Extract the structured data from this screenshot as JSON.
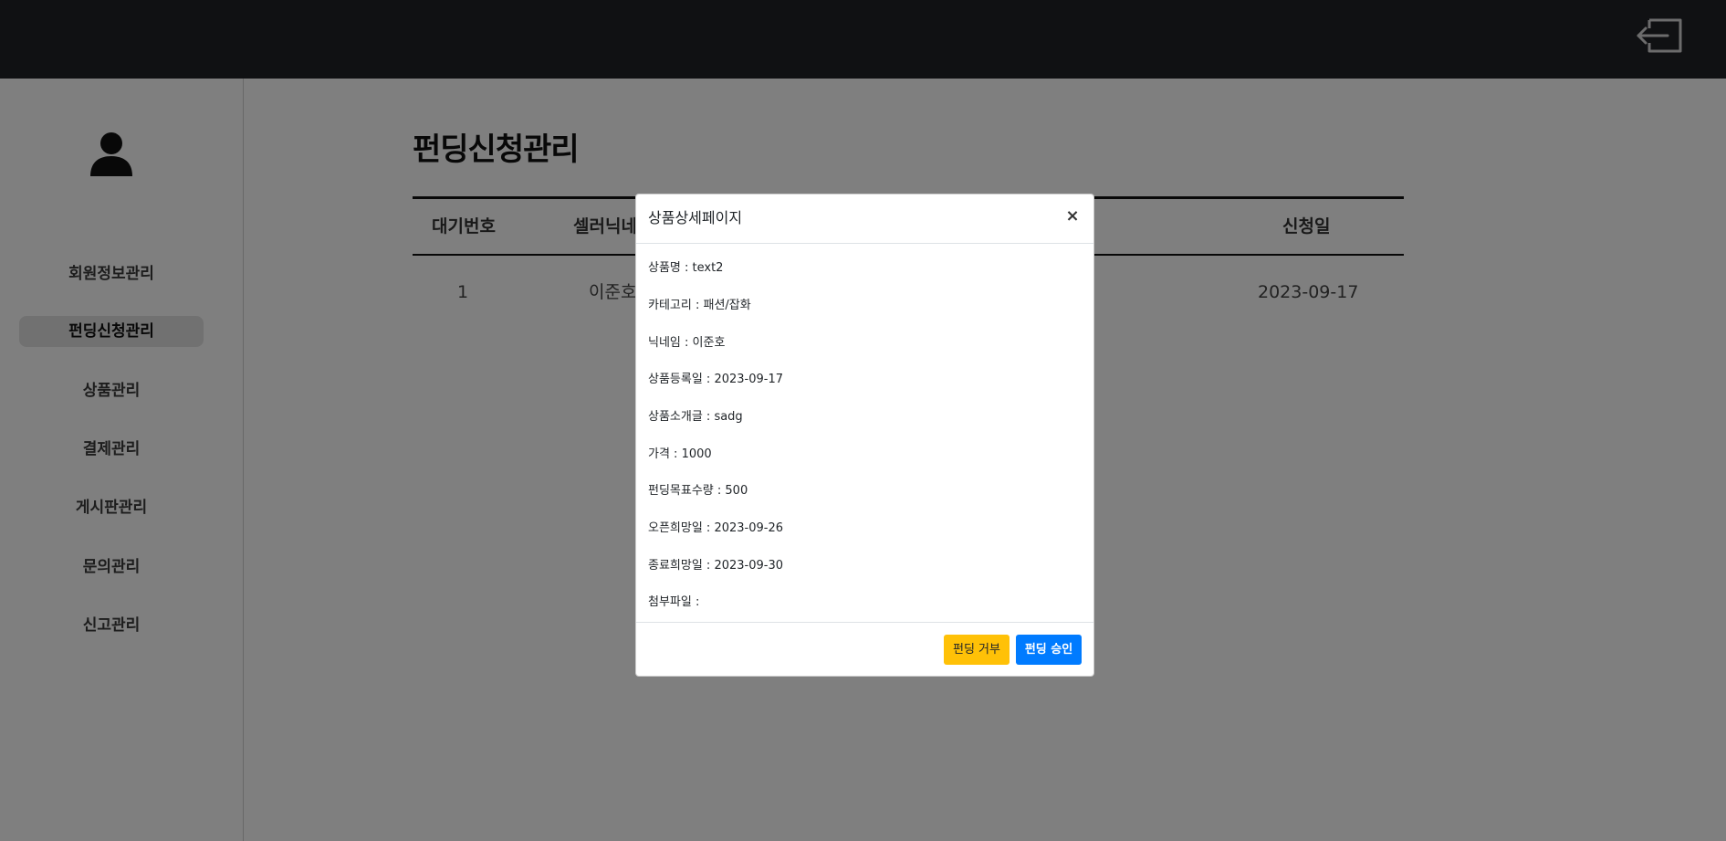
{
  "sidebar": {
    "items": [
      {
        "label": "회원정보관리"
      },
      {
        "label": "펀딩신청관리",
        "active": true
      },
      {
        "label": "상품관리"
      },
      {
        "label": "결제관리"
      },
      {
        "label": "게시판관리"
      },
      {
        "label": "문의관리"
      },
      {
        "label": "신고관리"
      }
    ]
  },
  "main": {
    "title": "펀딩신청관리",
    "table": {
      "headers": [
        "대기번호",
        "셀러닉네",
        "신청일"
      ],
      "rows": [
        [
          "1",
          "이준호",
          "2023-09-17"
        ]
      ]
    }
  },
  "modal": {
    "title": "상품상세페이지",
    "close_glyph": "×",
    "details": [
      "상품명 : text2",
      "카테고리 : 패션/잡화",
      "닉네임 : 이준호",
      "상품등록일 : 2023-09-17",
      "상품소개글 : sadg",
      "가격 : 1000",
      "펀딩목표수량 : 500",
      "오픈희망일 : 2023-09-26",
      "종료희망일 : 2023-09-30",
      "첨부파일 :"
    ],
    "reject_label": "펀딩 거부",
    "approve_label": "펀딩 승인"
  },
  "colors": {
    "topbar": "#212327",
    "reject": "#ffc107",
    "approve": "#007bff"
  },
  "icons": {
    "logout": "logout-icon",
    "avatar": "user-icon"
  }
}
